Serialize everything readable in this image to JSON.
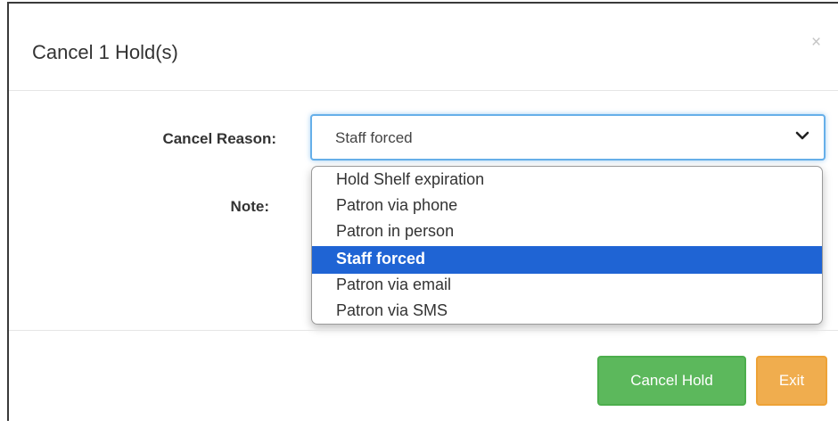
{
  "modal": {
    "title": "Cancel 1 Hold(s)",
    "close_glyph": "×"
  },
  "form": {
    "reason_label": "Cancel Reason:",
    "note_label": "Note:",
    "reason_select": {
      "value": "Staff forced",
      "options": [
        "Hold Shelf expiration",
        "Patron via phone",
        "Patron in person",
        "Staff forced",
        "Patron via email",
        "Patron via SMS"
      ],
      "selected_index": 3
    }
  },
  "footer": {
    "cancel_hold_label": "Cancel Hold",
    "exit_label": "Exit"
  },
  "colors": {
    "selected_option_bg": "#1f64d4",
    "success": "#5cb85c",
    "warning": "#f0ad4e",
    "focus": "#66afe9"
  },
  "icons": {
    "close": "close-icon",
    "select_caret": "chevron-down-icon"
  }
}
